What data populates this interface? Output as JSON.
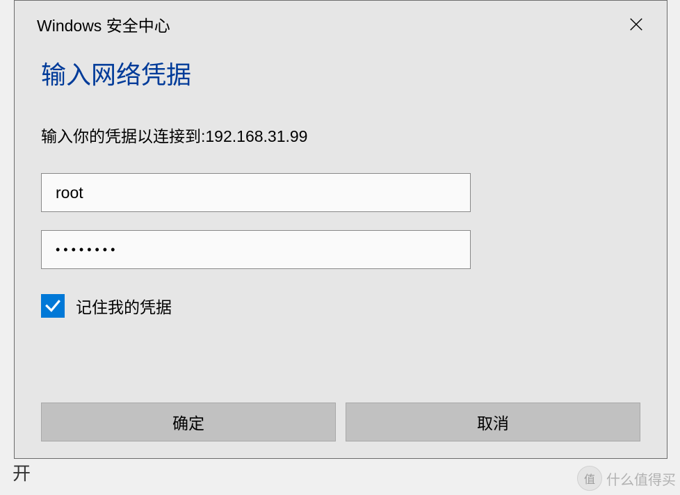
{
  "dialog": {
    "window_title": "Windows 安全中心",
    "heading": "输入网络凭据",
    "instruction": "输入你的凭据以连接到:192.168.31.99",
    "username_value": "root",
    "password_value": "••••••••",
    "remember_label": "记住我的凭据",
    "remember_checked": true,
    "ok_label": "确定",
    "cancel_label": "取消"
  },
  "watermark": {
    "badge": "值",
    "text": "什么值得买"
  }
}
